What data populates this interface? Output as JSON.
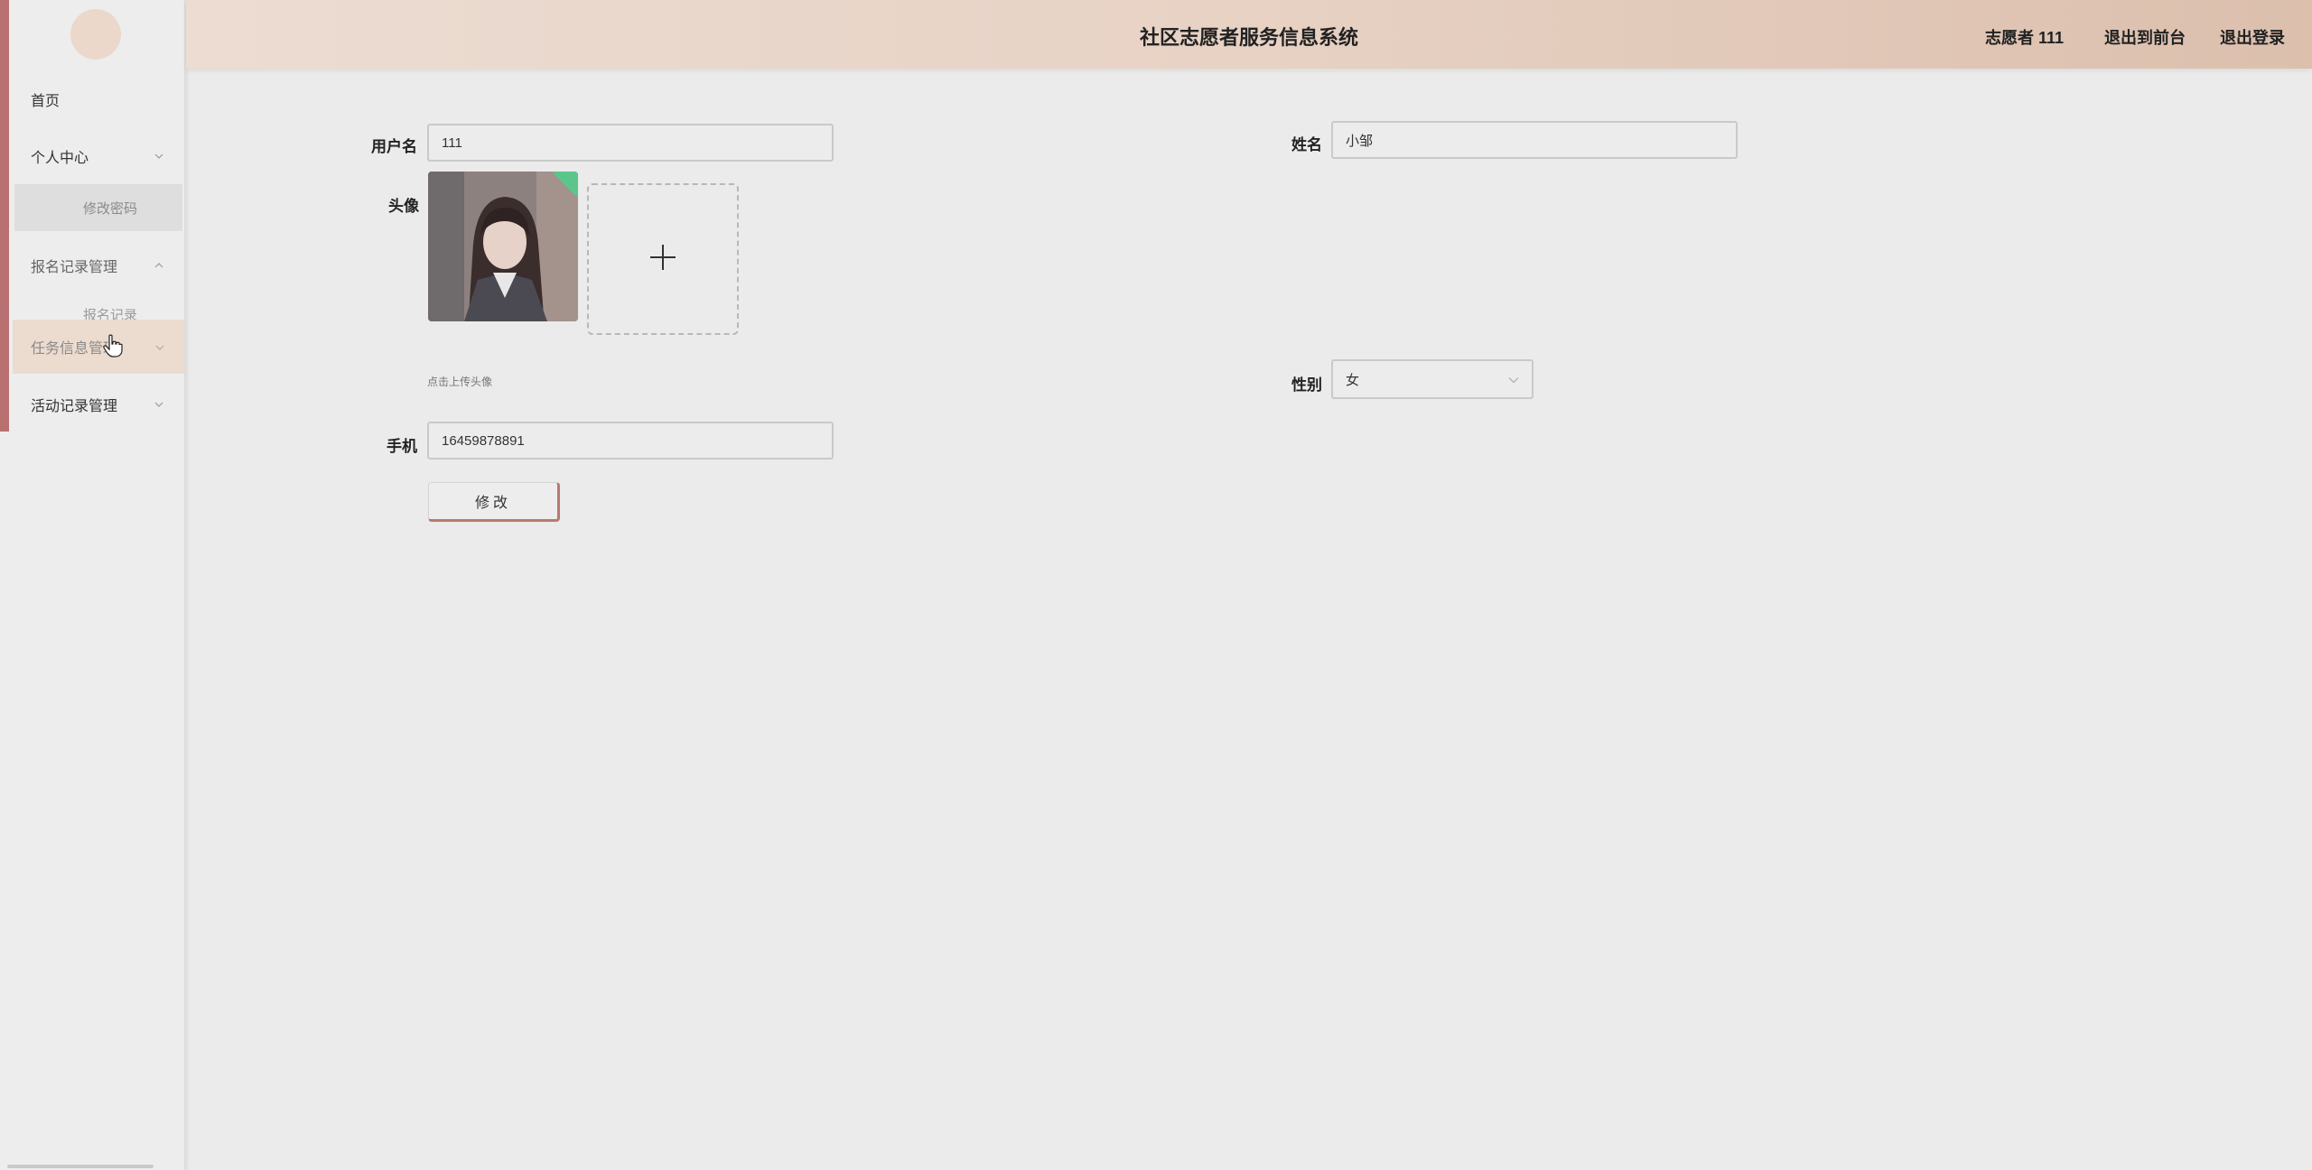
{
  "header": {
    "title": "社区志愿者服务信息系统",
    "user_label": "志愿者 111",
    "back_front": "退出到前台",
    "logout": "退出登录"
  },
  "sidebar": {
    "items": [
      {
        "label": "首页"
      },
      {
        "label": "个人中心"
      },
      {
        "label": "修改密码"
      },
      {
        "label": "报名记录管理"
      },
      {
        "label": "报名记录"
      },
      {
        "label": "任务信息管理"
      },
      {
        "label": "活动记录管理"
      }
    ]
  },
  "form": {
    "username_label": "用户名",
    "username_value": "111",
    "name_label": "姓名",
    "name_value": "小邹",
    "avatar_label": "头像",
    "upload_hint": "点击上传头像",
    "gender_label": "性别",
    "gender_value": "女",
    "phone_label": "手机",
    "phone_value": "16459878891",
    "submit_label": "修改"
  },
  "colors": {
    "sidebar_accent": "#b87070",
    "header_gradient_start": "#ecdcd2",
    "header_gradient_end": "#dcbfad",
    "button_border": "#b77a6f",
    "avatar_badge": "#5cc68a"
  },
  "icons": {
    "upload": "plus-icon",
    "chevron": "chevron-down-icon",
    "cursor": "hand-cursor-icon"
  }
}
